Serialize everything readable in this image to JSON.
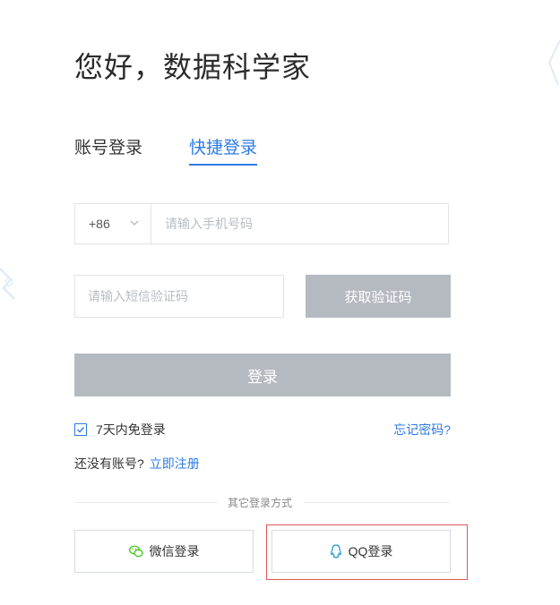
{
  "title": "您好，数据科学家",
  "tabs": {
    "account": "账号登录",
    "quick": "快捷登录"
  },
  "phone": {
    "country_code": "+86",
    "placeholder": "请输入手机号码"
  },
  "sms": {
    "placeholder": "请输入短信验证码",
    "get_code": "获取验证码"
  },
  "login_label": "登录",
  "remember_label": "7天内免登录",
  "forgot_label": "忘记密码?",
  "no_account_label": "还没有账号?",
  "register_label": "立即注册",
  "other_methods_label": "其它登录方式",
  "wechat_label": "微信登录",
  "qq_label": "QQ登录",
  "colors": {
    "accent": "#2d7be5",
    "disabled": "#b5bac1",
    "highlight": "#e05858",
    "wechat": "#2dc100"
  }
}
